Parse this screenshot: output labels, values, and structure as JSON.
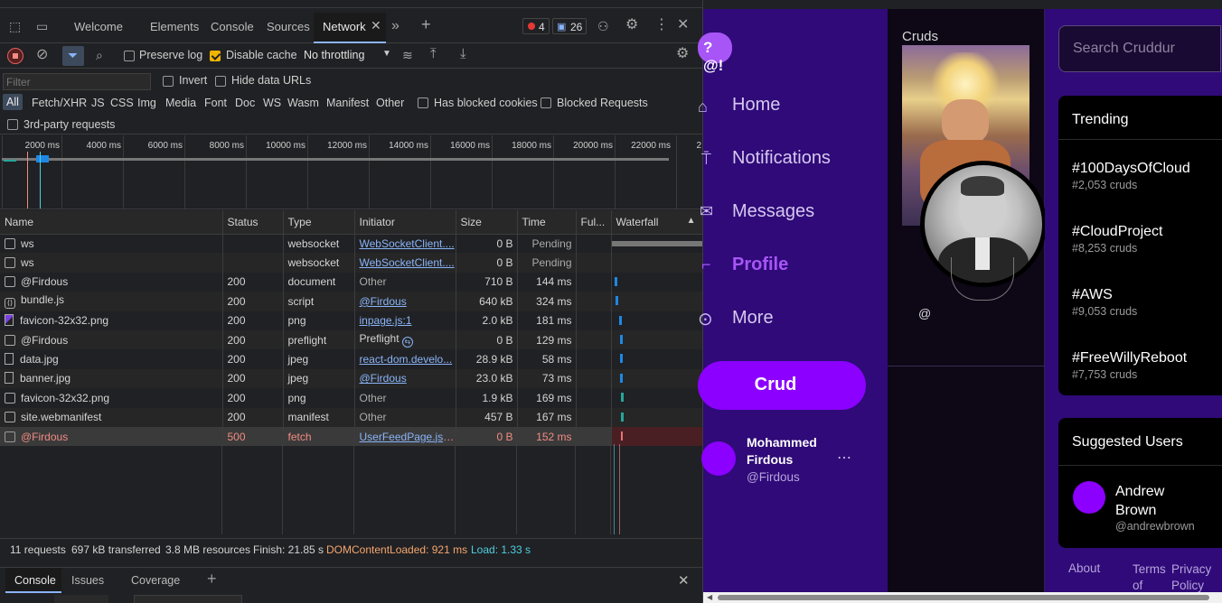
{
  "devtools": {
    "tabs": [
      "Welcome",
      "Elements",
      "Console",
      "Sources",
      "Network"
    ],
    "active_tab": "Network",
    "error_count": "4",
    "message_count": "26",
    "toolbar": {
      "preserve_log": "Preserve log",
      "disable_cache": "Disable cache",
      "throttling": "No throttling"
    },
    "filter": {
      "placeholder": "Filter",
      "invert": "Invert",
      "hide_data_urls": "Hide data URLs",
      "types": [
        "All",
        "Fetch/XHR",
        "JS",
        "CSS",
        "Img",
        "Media",
        "Font",
        "Doc",
        "WS",
        "Wasm",
        "Manifest",
        "Other"
      ],
      "has_blocked_cookies": "Has blocked cookies",
      "blocked_requests": "Blocked Requests",
      "third_party": "3rd-party requests"
    },
    "timeline_ticks": [
      "2000 ms",
      "4000 ms",
      "6000 ms",
      "8000 ms",
      "10000 ms",
      "12000 ms",
      "14000 ms",
      "16000 ms",
      "18000 ms",
      "20000 ms",
      "22000 ms",
      "2"
    ],
    "columns": [
      "Name",
      "Status",
      "Type",
      "Initiator",
      "Size",
      "Time",
      "Ful...",
      "Waterfall"
    ],
    "rows": [
      {
        "name": "ws",
        "status": "",
        "type": "websocket",
        "initiator": "WebSocketClient....",
        "size": "0 B",
        "time": "Pending"
      },
      {
        "name": "ws",
        "status": "",
        "type": "websocket",
        "initiator": "WebSocketClient....",
        "size": "0 B",
        "time": "Pending"
      },
      {
        "name": "@Firdous",
        "status": "200",
        "type": "document",
        "initiator": "Other",
        "size": "710 B",
        "time": "144 ms"
      },
      {
        "name": "bundle.js",
        "status": "200",
        "type": "script",
        "initiator": "@Firdous",
        "size": "640 kB",
        "time": "324 ms"
      },
      {
        "name": "favicon-32x32.png",
        "status": "200",
        "type": "png",
        "initiator": "inpage.js:1",
        "size": "2.0 kB",
        "time": "181 ms"
      },
      {
        "name": "@Firdous",
        "status": "200",
        "type": "preflight",
        "initiator": "Preflight",
        "size": "0 B",
        "time": "129 ms"
      },
      {
        "name": "data.jpg",
        "status": "200",
        "type": "jpeg",
        "initiator": "react-dom.develo...",
        "size": "28.9 kB",
        "time": "58 ms"
      },
      {
        "name": "banner.jpg",
        "status": "200",
        "type": "jpeg",
        "initiator": "@Firdous",
        "size": "23.0 kB",
        "time": "73 ms"
      },
      {
        "name": "favicon-32x32.png",
        "status": "200",
        "type": "png",
        "initiator": "Other",
        "size": "1.9 kB",
        "time": "169 ms"
      },
      {
        "name": "site.webmanifest",
        "status": "200",
        "type": "manifest",
        "initiator": "Other",
        "size": "457 B",
        "time": "167 ms"
      },
      {
        "name": "@Firdous",
        "status": "500",
        "type": "fetch",
        "initiator": "UserFeedPage.js:30",
        "size": "0 B",
        "time": "152 ms"
      }
    ],
    "status": {
      "requests": "11 requests",
      "transferred": "697 kB transferred",
      "resources": "3.8 MB resources",
      "finish": "Finish: 21.85 s",
      "dom": "DOMContentLoaded: 921 ms",
      "load": "Load: 1.33 s"
    },
    "drawer_tabs": [
      "Console",
      "Issues",
      "Coverage"
    ]
  },
  "app": {
    "logo": "?@!",
    "nav": [
      "Home",
      "Notifications",
      "Messages",
      "Profile",
      "More"
    ],
    "crud_button": "Crud",
    "user_name": "Mohammed Firdous",
    "user_handle": "@Firdous",
    "center_title": "Cruds",
    "center_at": "@",
    "search_placeholder": "Search Cruddur",
    "trending_title": "Trending",
    "trends": [
      {
        "tag": "#100DaysOfCloud",
        "count": "#2,053 cruds"
      },
      {
        "tag": "#CloudProject",
        "count": "#8,253 cruds"
      },
      {
        "tag": "#AWS",
        "count": "#9,053 cruds"
      },
      {
        "tag": "#FreeWillyReboot",
        "count": "#7,753 cruds"
      }
    ],
    "suggested_title": "Suggested Users",
    "suggested_user": {
      "name": "Andrew Brown",
      "handle": "@andrewbrown"
    },
    "footer": [
      "About",
      "Terms of",
      "Privacy Policy"
    ]
  }
}
